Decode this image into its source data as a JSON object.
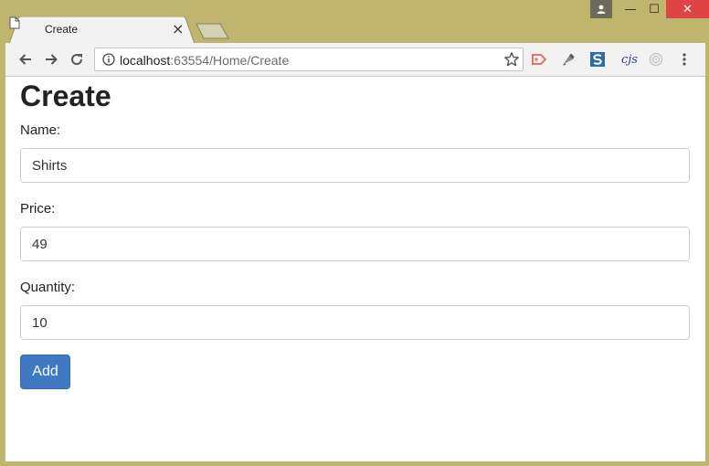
{
  "window": {
    "minimize_label": "—",
    "maximize_label": "☐",
    "close_label": "✕"
  },
  "tab": {
    "title": "Create",
    "close_label": "×"
  },
  "address_bar": {
    "host": "localhost",
    "path": ":63554/Home/Create"
  },
  "extensions": {
    "cjs_label": "cjs"
  },
  "page": {
    "heading": "Create",
    "fields": [
      {
        "label": "Name:",
        "value": "Shirts"
      },
      {
        "label": "Price:",
        "value": "49"
      },
      {
        "label": "Quantity:",
        "value": "10"
      }
    ],
    "submit_label": "Add"
  },
  "colors": {
    "frame": "#bfb56e",
    "primary_button": "#3f79c1",
    "close_button": "#e04343"
  }
}
